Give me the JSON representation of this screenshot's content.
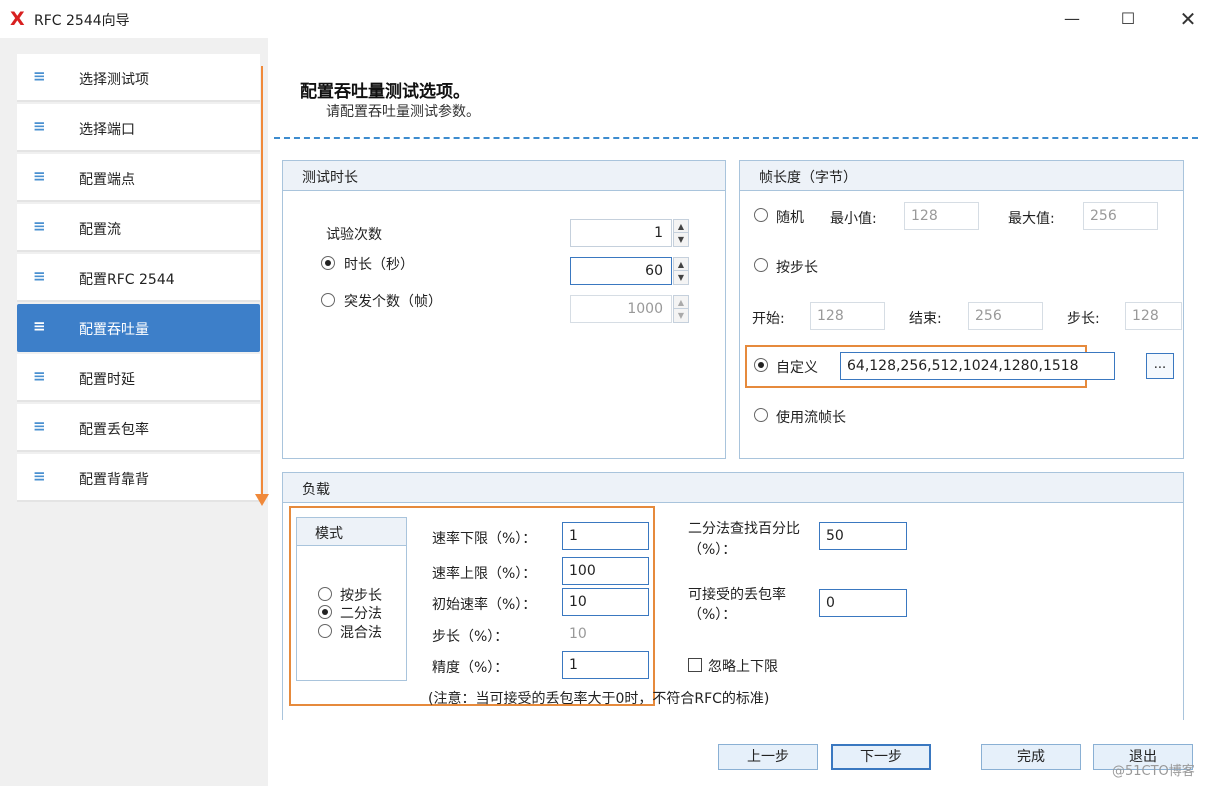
{
  "window": {
    "logo": "X",
    "title": "RFC 2544向导",
    "minimize": "—",
    "maximize": "☐",
    "close": "✕"
  },
  "sidebar": {
    "items": [
      {
        "label": "选择测试项",
        "active": false
      },
      {
        "label": "选择端口",
        "active": false
      },
      {
        "label": "配置端点",
        "active": false
      },
      {
        "label": "配置流",
        "active": false
      },
      {
        "label": "配置RFC 2544",
        "active": false
      },
      {
        "label": "配置吞吐量",
        "active": true
      },
      {
        "label": "配置时延",
        "active": false
      },
      {
        "label": "配置丢包率",
        "active": false
      },
      {
        "label": "配置背靠背",
        "active": false
      }
    ],
    "icon": "≡"
  },
  "page": {
    "heading": "配置吞吐量测试选项。",
    "subheading": "请配置吞吐量测试参数。"
  },
  "test_duration": {
    "title": "测试时长",
    "trials_label": "试验次数",
    "trials_value": "1",
    "duration_label": "时长（秒）",
    "duration_value": "60",
    "duration_checked": true,
    "burst_label": "突发个数（帧）",
    "burst_value": "1000",
    "burst_checked": false
  },
  "frame_length": {
    "title": "帧长度（字节）",
    "random_label": "随机",
    "min_label": "最小值:",
    "min_value": "128",
    "max_label": "最大值:",
    "max_value": "256",
    "step_label": "按步长",
    "start_label": "开始:",
    "start_value": "128",
    "end_label": "结束:",
    "end_value": "256",
    "stepsize_label": "步长:",
    "stepsize_value": "128",
    "custom_label": "自定义",
    "custom_value": "64,128,256,512,1024,1280,1518",
    "custom_checked": true,
    "browse_label": "...",
    "use_stream_label": "使用流帧长"
  },
  "load": {
    "title": "负载",
    "mode_title": "模式",
    "mode_step": "按步长",
    "mode_binary": "二分法",
    "mode_mixed": "混合法",
    "mode_selected": "二分法",
    "rate_min_label": "速率下限（%）：",
    "rate_min_value": "1",
    "rate_max_label": "速率上限（%）：",
    "rate_max_value": "100",
    "rate_init_label": "初始速率（%）：",
    "rate_init_value": "10",
    "step_label": "步长（%）：",
    "step_value": "10",
    "precision_label": "精度（%）：",
    "precision_value": "1",
    "note": "(注意：当可接受的丢包率大于0时，不符合RFC的标准)",
    "binary_pct_label_1": "二分法查找百分比",
    "binary_pct_label_2": "（%）：",
    "binary_pct_value": "50",
    "loss_label_1": "可接受的丢包率",
    "loss_label_2": "（%）：",
    "loss_value": "0",
    "ignore_label": "忽略上下限"
  },
  "footer": {
    "prev": "上一步",
    "next": "下一步",
    "finish": "完成",
    "exit": "退出"
  },
  "watermark": "@51CTO博客",
  "colors": {
    "accent": "#3d7fc9",
    "highlight": "#e68a3c",
    "group_border": "#a9c4dc"
  }
}
